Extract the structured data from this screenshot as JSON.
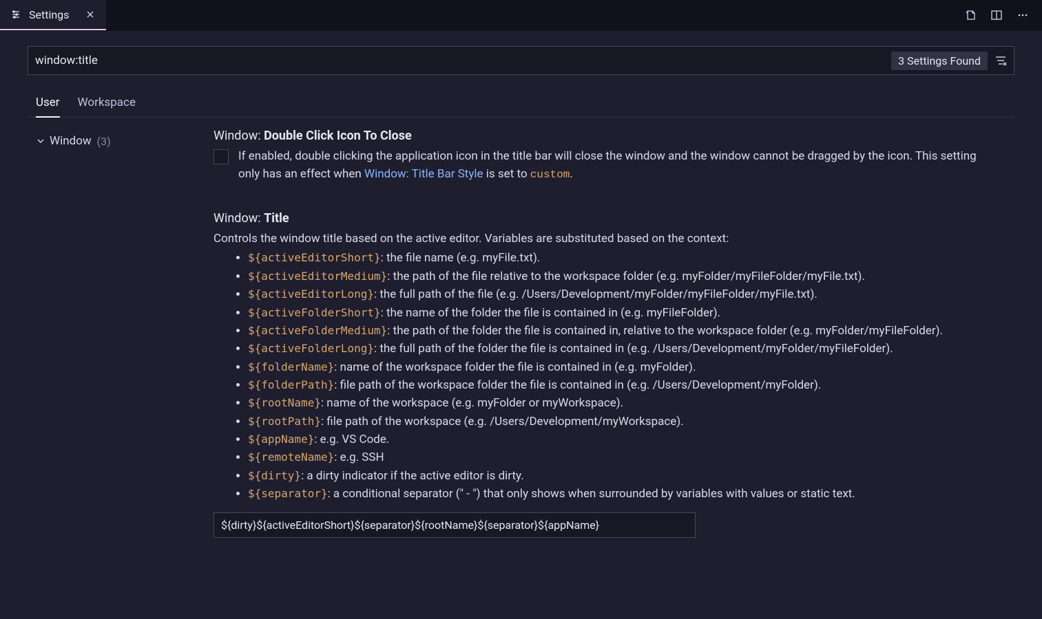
{
  "tab": {
    "title": "Settings"
  },
  "search": {
    "value": "window:title",
    "found_label": "3 Settings Found"
  },
  "scopes": {
    "user": "User",
    "workspace": "Workspace"
  },
  "tree": {
    "window_label": "Window",
    "window_count": "(3)"
  },
  "setting1": {
    "scope": "Window:",
    "name": "Double Click Icon To Close",
    "desc_a": "If enabled, double clicking the application icon in the title bar will close the window and the window cannot be dragged by the icon. This setting only has an effect when ",
    "link": "Window: Title Bar Style",
    "desc_b": " is set to ",
    "code": "custom",
    "desc_c": "."
  },
  "setting2": {
    "scope": "Window:",
    "name": "Title",
    "intro": "Controls the window title based on the active editor. Variables are substituted based on the context:",
    "vars": [
      {
        "code": "${activeEditorShort}",
        "text": ": the file name (e.g. myFile.txt)."
      },
      {
        "code": "${activeEditorMedium}",
        "text": ": the path of the file relative to the workspace folder (e.g. myFolder/myFileFolder/myFile.txt)."
      },
      {
        "code": "${activeEditorLong}",
        "text": ": the full path of the file (e.g. /Users/Development/myFolder/myFileFolder/myFile.txt)."
      },
      {
        "code": "${activeFolderShort}",
        "text": ": the name of the folder the file is contained in (e.g. myFileFolder)."
      },
      {
        "code": "${activeFolderMedium}",
        "text": ": the path of the folder the file is contained in, relative to the workspace folder (e.g. myFolder/myFileFolder)."
      },
      {
        "code": "${activeFolderLong}",
        "text": ": the full path of the folder the file is contained in (e.g. /Users/Development/myFolder/myFileFolder)."
      },
      {
        "code": "${folderName}",
        "text": ": name of the workspace folder the file is contained in (e.g. myFolder)."
      },
      {
        "code": "${folderPath}",
        "text": ": file path of the workspace folder the file is contained in (e.g. /Users/Development/myFolder)."
      },
      {
        "code": "${rootName}",
        "text": ": name of the workspace (e.g. myFolder or myWorkspace)."
      },
      {
        "code": "${rootPath}",
        "text": ": file path of the workspace (e.g. /Users/Development/myWorkspace)."
      },
      {
        "code": "${appName}",
        "text": ": e.g. VS Code."
      },
      {
        "code": "${remoteName}",
        "text": ": e.g. SSH"
      },
      {
        "code": "${dirty}",
        "text": ": a dirty indicator if the active editor is dirty."
      },
      {
        "code": "${separator}",
        "text": ": a conditional separator (\" - \") that only shows when surrounded by variables with values or static text."
      }
    ],
    "value": "${dirty}${activeEditorShort}${separator}${rootName}${separator}${appName}"
  }
}
